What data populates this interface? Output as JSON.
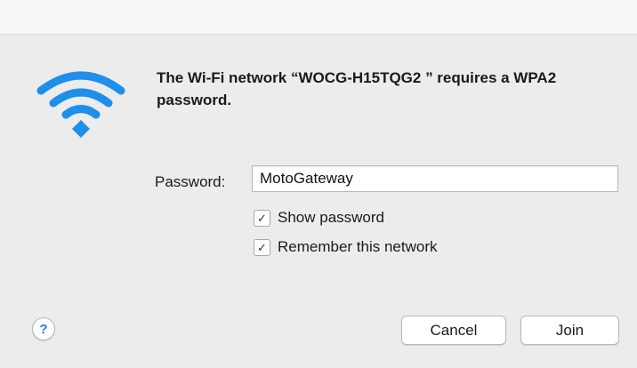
{
  "dialog": {
    "message": "The Wi-Fi network “WOCG-H15TQG2 ” requires a WPA2 password.",
    "icon": "wifi-icon",
    "accent_color": "#1e8fea"
  },
  "password": {
    "label": "Password:",
    "value": "MotoGateway"
  },
  "options": {
    "show_password": {
      "label": "Show password",
      "checked": true
    },
    "remember_network": {
      "label": "Remember this network",
      "checked": true
    }
  },
  "buttons": {
    "help": "?",
    "cancel": "Cancel",
    "join": "Join"
  }
}
